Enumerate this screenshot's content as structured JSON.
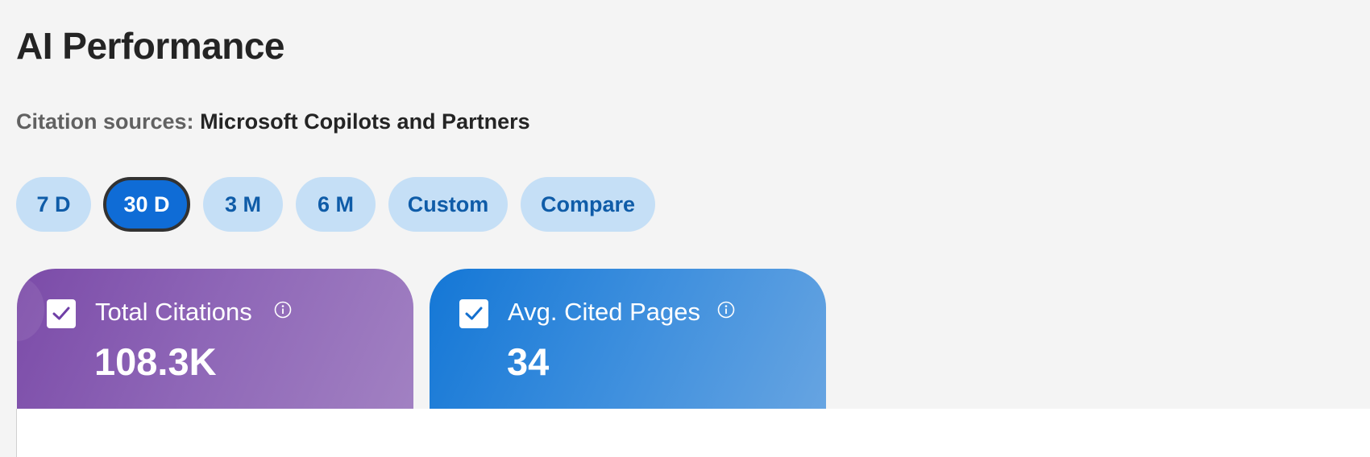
{
  "header": {
    "title": "AI Performance"
  },
  "citation_sources": {
    "label": "Citation sources:",
    "value": "Microsoft Copilots and Partners"
  },
  "time_ranges": {
    "selected": "30 D",
    "options": [
      "7 D",
      "30 D",
      "3 M",
      "6 M",
      "Custom",
      "Compare"
    ]
  },
  "metrics": [
    {
      "label": "Total Citations",
      "value": "108.3K",
      "checked": true,
      "icon": "info-icon",
      "color_start": "#7b4ba8",
      "color_end": "#a383c3"
    },
    {
      "label": "Avg. Cited Pages",
      "value": "34",
      "checked": true,
      "icon": "info-icon",
      "color_start": "#1477d6",
      "color_end": "#6aa6e2"
    }
  ],
  "colors": {
    "accent": "#0f6cd6",
    "pill_bg": "#c5dff6",
    "pill_text": "#0f5ca8",
    "page_bg": "#f4f4f4"
  }
}
